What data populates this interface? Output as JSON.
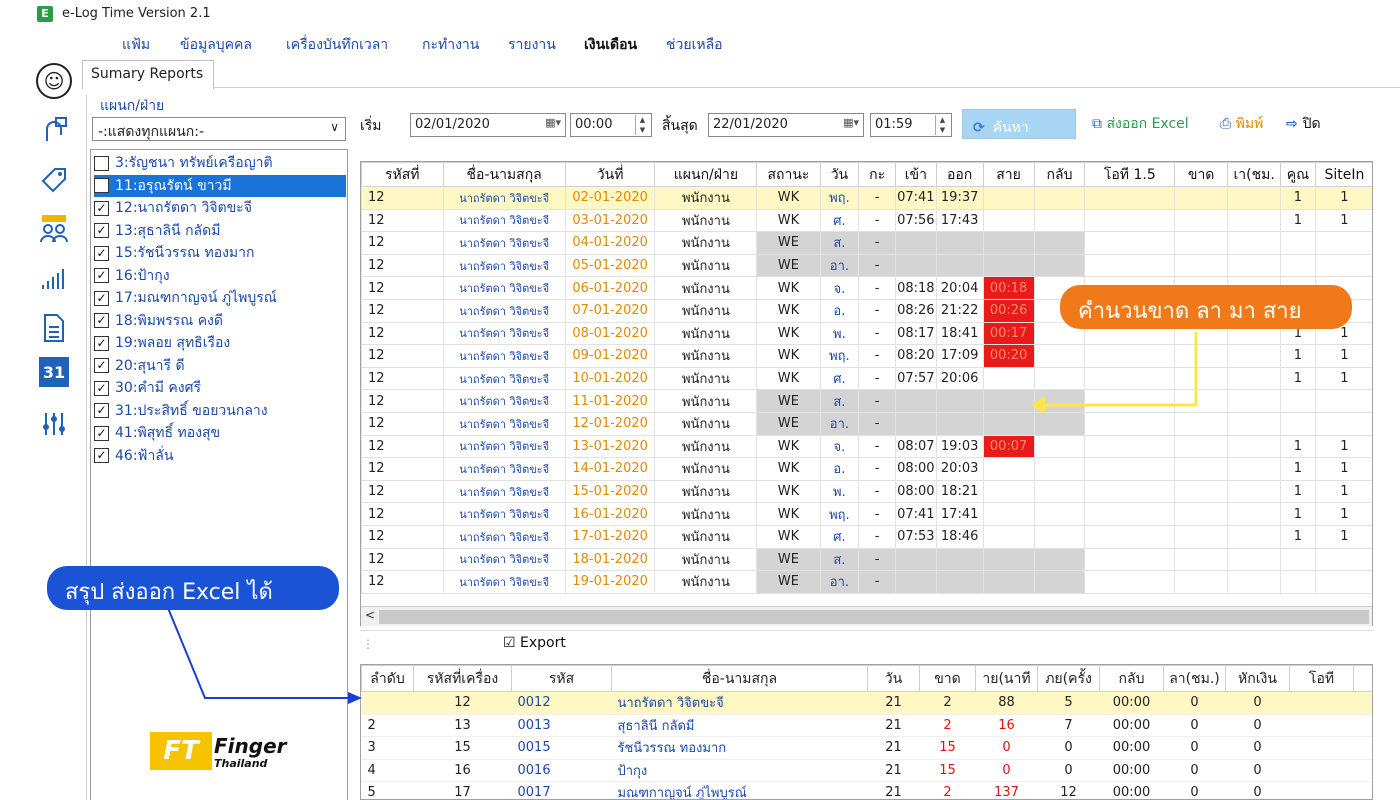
{
  "app": {
    "title": "e-Log Time Version 2.1",
    "icon_letter": "E"
  },
  "menu": [
    "แฟ้ม",
    "ข้อมูลบุคคล",
    "เครื่องบันทึกเวลา",
    "กะทำงาน",
    "รายงาน",
    "เงินเดือน",
    "ช่วยเหลือ"
  ],
  "active_menu": "เงินเดือน",
  "tab": {
    "label": "Sumary Reports"
  },
  "nav_icons": [
    "user-icon",
    "finger-scan-icon",
    "tag-icon",
    "people-icon",
    "chart-icon",
    "document-icon",
    "calendar-icon",
    "settings-icon"
  ],
  "calendar_day": "31",
  "department": {
    "legend": "แผนก/ฝ่าย",
    "selected": "-:แสดงทุกแผนก:-"
  },
  "employees": [
    {
      "label": "3:รัญชนา ทรัพย์เครือญาติ",
      "checked": false,
      "selected": false
    },
    {
      "label": "11:อรุณรัตน์ ขาวมี",
      "checked": false,
      "selected": true
    },
    {
      "label": "12:นาถรัตดา วิจิตขะจี",
      "checked": true,
      "selected": false
    },
    {
      "label": "13:สุธาลินี กลัดมี",
      "checked": true,
      "selected": false
    },
    {
      "label": "15:รัชนีวรรณ ทองมาก",
      "checked": true,
      "selected": false
    },
    {
      "label": "16:ป้ากุง",
      "checked": true,
      "selected": false
    },
    {
      "label": "17:มณฑกาญจน์ ภู่ไพบูรณ์",
      "checked": true,
      "selected": false
    },
    {
      "label": "18:พิมพรรณ คงดี",
      "checked": true,
      "selected": false
    },
    {
      "label": "19:พลอย สุทธิเรือง",
      "checked": true,
      "selected": false
    },
    {
      "label": "20:สุนารี ดี",
      "checked": true,
      "selected": false
    },
    {
      "label": "30:คำมี คงศรี",
      "checked": true,
      "selected": false
    },
    {
      "label": "31:ประสิทธิ์ ขอยวนกลาง",
      "checked": true,
      "selected": false
    },
    {
      "label": "41:พิสุทธิ์ ทองสุข",
      "checked": true,
      "selected": false
    },
    {
      "label": "46:ฟ้าลั่น",
      "checked": true,
      "selected": false
    }
  ],
  "toolbar": {
    "start_label": "เริ่ม",
    "start_date": "02/01/2020",
    "start_time": "00:00",
    "end_label": "สิ้นสุด",
    "end_date": "22/01/2020",
    "end_time": "01:59",
    "search_label": "ค้นหา",
    "excel_label": "ส่งออก Excel",
    "print_label": "พิมพ์",
    "close_label": "ปิด"
  },
  "grid": {
    "headers": [
      "รหัสที่",
      "ชื่อ-นามสกุล",
      "วันที่",
      "แผนก/ฝ่าย",
      "สถานะ",
      "วัน",
      "กะ",
      "เข้า",
      "ออก",
      "สาย",
      "กลับ",
      "โอที 1.5",
      "ขาด",
      "เา(ชม.",
      "คูณ",
      "SiteIn"
    ],
    "rows": [
      {
        "id": "12",
        "name": "นาถรัตดา วิจิตขะจี",
        "date": "02-01-2020",
        "dept": "พนักงาน",
        "status": "WK",
        "day": "พฤ.",
        "shift": "-",
        "in": "07:41",
        "out": "19:37",
        "late": "",
        "mult": "1",
        "site": "1"
      },
      {
        "id": "12",
        "name": "นาถรัตดา วิจิตขะจี",
        "date": "03-01-2020",
        "dept": "พนักงาน",
        "status": "WK",
        "day": "ศ.",
        "shift": "-",
        "in": "07:56",
        "out": "17:43",
        "late": "",
        "mult": "1",
        "site": "1"
      },
      {
        "id": "12",
        "name": "นาถรัตดา วิจิตขะจี",
        "date": "04-01-2020",
        "dept": "พนักงาน",
        "status": "WE",
        "day": "ส.",
        "shift": "-",
        "in": "",
        "out": "",
        "late": "",
        "mult": "",
        "site": ""
      },
      {
        "id": "12",
        "name": "นาถรัตดา วิจิตขะจี",
        "date": "05-01-2020",
        "dept": "พนักงาน",
        "status": "WE",
        "day": "อา.",
        "shift": "-",
        "in": "",
        "out": "",
        "late": "",
        "mult": "",
        "site": ""
      },
      {
        "id": "12",
        "name": "นาถรัตดา วิจิตขะจี",
        "date": "06-01-2020",
        "dept": "พนักงาน",
        "status": "WK",
        "day": "จ.",
        "shift": "-",
        "in": "08:18",
        "out": "20:04",
        "late": "00:18",
        "mult": "",
        "site": ""
      },
      {
        "id": "12",
        "name": "นาถรัตดา วิจิตขะจี",
        "date": "07-01-2020",
        "dept": "พนักงาน",
        "status": "WK",
        "day": "อ.",
        "shift": "-",
        "in": "08:26",
        "out": "21:22",
        "late": "00:26",
        "mult": "",
        "site": ""
      },
      {
        "id": "12",
        "name": "นาถรัตดา วิจิตขะจี",
        "date": "08-01-2020",
        "dept": "พนักงาน",
        "status": "WK",
        "day": "พ.",
        "shift": "-",
        "in": "08:17",
        "out": "18:41",
        "late": "00:17",
        "mult": "1",
        "site": "1"
      },
      {
        "id": "12",
        "name": "นาถรัตดา วิจิตขะจี",
        "date": "09-01-2020",
        "dept": "พนักงาน",
        "status": "WK",
        "day": "พฤ.",
        "shift": "-",
        "in": "08:20",
        "out": "17:09",
        "late": "00:20",
        "mult": "1",
        "site": "1"
      },
      {
        "id": "12",
        "name": "นาถรัตดา วิจิตขะจี",
        "date": "10-01-2020",
        "dept": "พนักงาน",
        "status": "WK",
        "day": "ศ.",
        "shift": "-",
        "in": "07:57",
        "out": "20:06",
        "late": "",
        "mult": "1",
        "site": "1"
      },
      {
        "id": "12",
        "name": "นาถรัตดา วิจิตขะจี",
        "date": "11-01-2020",
        "dept": "พนักงาน",
        "status": "WE",
        "day": "ส.",
        "shift": "-",
        "in": "",
        "out": "",
        "late": "",
        "mult": "",
        "site": ""
      },
      {
        "id": "12",
        "name": "นาถรัตดา วิจิตขะจี",
        "date": "12-01-2020",
        "dept": "พนักงาน",
        "status": "WE",
        "day": "อา.",
        "shift": "-",
        "in": "",
        "out": "",
        "late": "",
        "mult": "",
        "site": ""
      },
      {
        "id": "12",
        "name": "นาถรัตดา วิจิตขะจี",
        "date": "13-01-2020",
        "dept": "พนักงาน",
        "status": "WK",
        "day": "จ.",
        "shift": "-",
        "in": "08:07",
        "out": "19:03",
        "late": "00:07",
        "mult": "1",
        "site": "1"
      },
      {
        "id": "12",
        "name": "นาถรัตดา วิจิตขะจี",
        "date": "14-01-2020",
        "dept": "พนักงาน",
        "status": "WK",
        "day": "อ.",
        "shift": "-",
        "in": "08:00",
        "out": "20:03",
        "late": "",
        "mult": "1",
        "site": "1"
      },
      {
        "id": "12",
        "name": "นาถรัตดา วิจิตขะจี",
        "date": "15-01-2020",
        "dept": "พนักงาน",
        "status": "WK",
        "day": "พ.",
        "shift": "-",
        "in": "08:00",
        "out": "18:21",
        "late": "",
        "mult": "1",
        "site": "1"
      },
      {
        "id": "12",
        "name": "นาถรัตดา วิจิตขะจี",
        "date": "16-01-2020",
        "dept": "พนักงาน",
        "status": "WK",
        "day": "พฤ.",
        "shift": "-",
        "in": "07:41",
        "out": "17:41",
        "late": "",
        "mult": "1",
        "site": "1"
      },
      {
        "id": "12",
        "name": "นาถรัตดา วิจิตขะจี",
        "date": "17-01-2020",
        "dept": "พนักงาน",
        "status": "WK",
        "day": "ศ.",
        "shift": "-",
        "in": "07:53",
        "out": "18:46",
        "late": "",
        "mult": "1",
        "site": "1"
      },
      {
        "id": "12",
        "name": "นาถรัตดา วิจิตขะจี",
        "date": "18-01-2020",
        "dept": "พนักงาน",
        "status": "WE",
        "day": "ส.",
        "shift": "-",
        "in": "",
        "out": "",
        "late": "",
        "mult": "",
        "site": ""
      },
      {
        "id": "12",
        "name": "นาถรัตดา วิจิตขะจี",
        "date": "19-01-2020",
        "dept": "พนักงาน",
        "status": "WE",
        "day": "อา.",
        "shift": "-",
        "in": "",
        "out": "",
        "late": "",
        "mult": "",
        "site": ""
      }
    ]
  },
  "export": {
    "label": "Export"
  },
  "summary": {
    "headers": [
      "ลำดับ",
      "รหัสที่เครื่อง",
      "รหัส",
      "ชื่อ-นามสกุล",
      "วัน",
      "ขาด",
      "าย(นาที",
      "ภย(ครั้ง",
      "กลับ",
      "ลา(ชม.)",
      "หักเงิน",
      "โอที"
    ],
    "rows": [
      {
        "no": "",
        "machine": "12",
        "code": "0012",
        "name": "นาถรัตดา วิจิตขะจี",
        "days": "21",
        "absent": "2",
        "late_min": "88",
        "late_times": "5",
        "early": "00:00",
        "leave": "0",
        "deduct": "0"
      },
      {
        "no": "2",
        "machine": "13",
        "code": "0013",
        "name": "สุธาลินี กลัดมี",
        "days": "21",
        "absent": "2",
        "late_min": "16",
        "late_times": "7",
        "early": "00:00",
        "leave": "0",
        "deduct": "0"
      },
      {
        "no": "3",
        "machine": "15",
        "code": "0015",
        "name": "รัชนีวรรณ ทองมาก",
        "days": "21",
        "absent": "15",
        "late_min": "0",
        "late_times": "0",
        "early": "00:00",
        "leave": "0",
        "deduct": "0"
      },
      {
        "no": "4",
        "machine": "16",
        "code": "0016",
        "name": "ป้ากุง",
        "days": "21",
        "absent": "15",
        "late_min": "0",
        "late_times": "0",
        "early": "00:00",
        "leave": "0",
        "deduct": "0"
      },
      {
        "no": "5",
        "machine": "17",
        "code": "0017",
        "name": "มณฑกาญจน์ ภู่ไพบูรณ์",
        "days": "21",
        "absent": "2",
        "late_min": "137",
        "late_times": "12",
        "early": "00:00",
        "leave": "0",
        "deduct": "0"
      }
    ]
  },
  "callouts": {
    "orange": "คำนวนขาด ลา มา สาย",
    "blue": "สรุป ส่งออก Excel ได้"
  },
  "logo": {
    "ft": "FT",
    "finger": "Finger",
    "thailand": "Thailand"
  },
  "colors": {
    "accent": "#1a73d8",
    "late": "#e81a1a",
    "weekend": "#d4d4d4",
    "highlight": "#fff8c4",
    "orange": "#f07a1a",
    "blue_callout": "#1a53d6"
  }
}
